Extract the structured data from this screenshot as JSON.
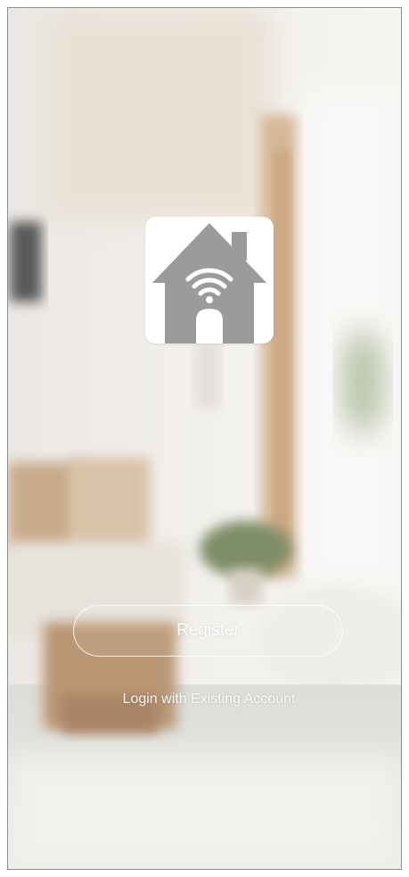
{
  "app": {
    "logo_icon": "smart-home-wifi-house-icon",
    "background": "blurred-living-room-photo"
  },
  "auth": {
    "register_label": "Register",
    "login_label": "Login with Existing Account"
  },
  "colors": {
    "logo_tile": "#ffffff",
    "house_gray": "#9a9b9d",
    "button_outline": "#ffffff",
    "text": "#ffffff"
  }
}
